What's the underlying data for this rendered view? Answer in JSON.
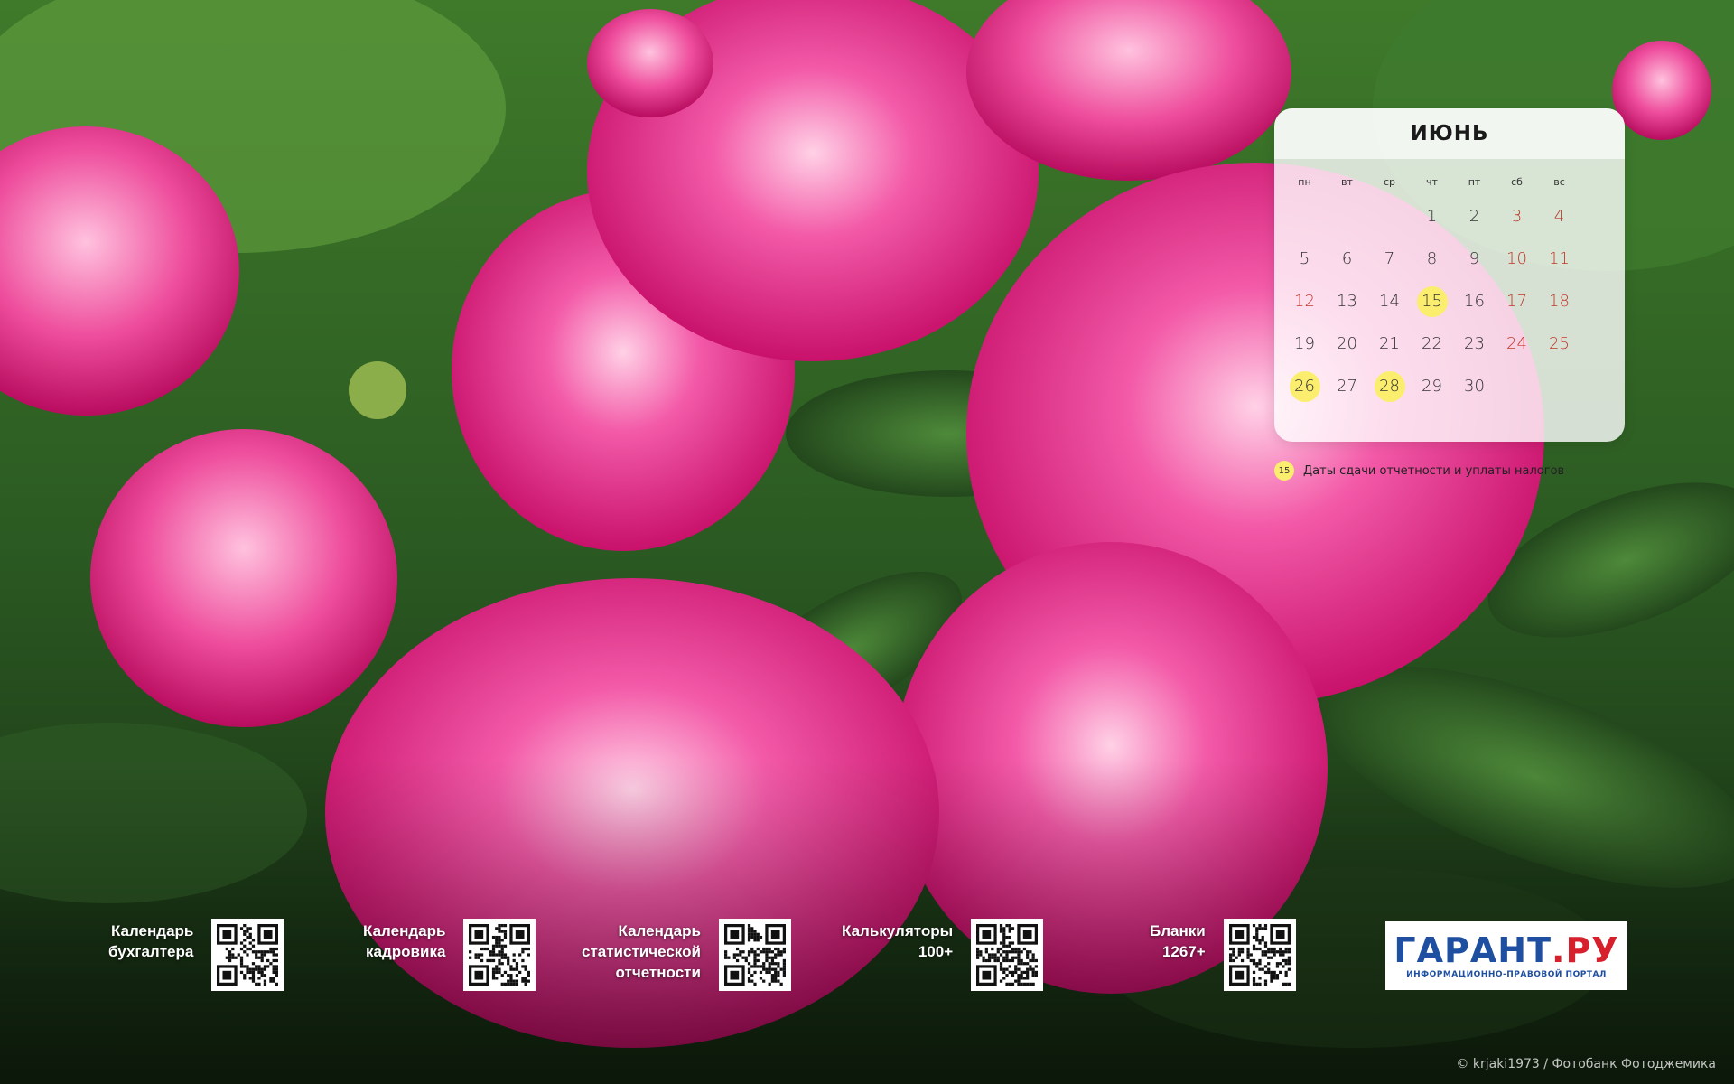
{
  "calendar": {
    "month": "ИЮНЬ",
    "weekdays": [
      "пн",
      "вт",
      "ср",
      "чт",
      "пт",
      "сб",
      "вс"
    ],
    "weeks": [
      [
        "",
        "",
        "",
        "1",
        "2",
        "3",
        "4"
      ],
      [
        "5",
        "6",
        "7",
        "8",
        "9",
        "10",
        "11"
      ],
      [
        "12",
        "13",
        "14",
        "15",
        "16",
        "17",
        "18"
      ],
      [
        "19",
        "20",
        "21",
        "22",
        "23",
        "24",
        "25"
      ],
      [
        "26",
        "27",
        "28",
        "29",
        "30",
        "",
        ""
      ]
    ],
    "holidays": [
      "12"
    ],
    "highlighted": [
      "15",
      "26",
      "28"
    ],
    "highlight_color": "#fbee6e",
    "weekend_color": "#c0392b"
  },
  "legend": {
    "sample_day": "15",
    "text": "Даты сдачи отчетности и уплаты налогов"
  },
  "links": [
    {
      "label": "Календарь\nбухгалтера"
    },
    {
      "label": "Календарь\nкадровика"
    },
    {
      "label": "Календарь\nстатистической\nотчетности"
    },
    {
      "label": "Калькуляторы\n100+"
    },
    {
      "label": "Бланки\n1267+"
    }
  ],
  "logo": {
    "main": "ГАРАНТ",
    "dot": ".",
    "tld": "РУ",
    "subtitle": "ИНФОРМАЦИОННО-ПРАВОВОЙ ПОРТАЛ",
    "color": "#1f4fa0",
    "accent": "#d6202c"
  },
  "credit": "© krjaki1973 / Фотобанк Фотоджемика"
}
